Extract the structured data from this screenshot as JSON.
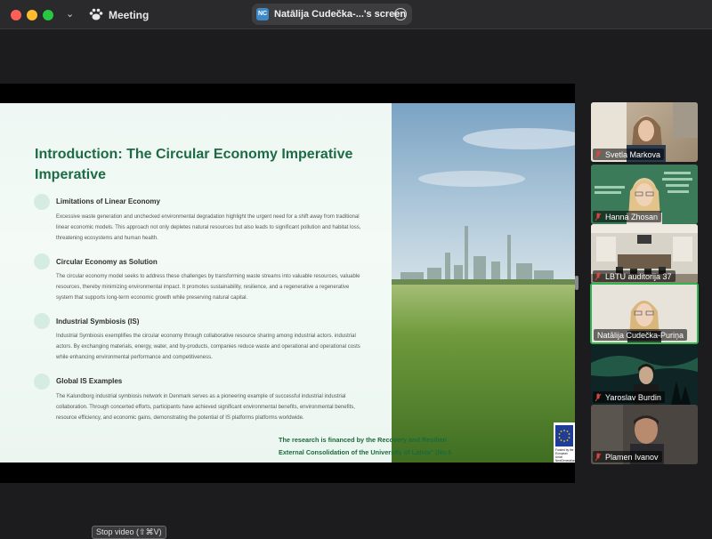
{
  "window": {
    "meeting_title": "Meeting",
    "share_badge": "NC",
    "share_label": "Natālija Cudečka-...'s screen"
  },
  "slide": {
    "title_line1": "Introduction: The Circular Economy Imperative",
    "title_line2": "Imperative",
    "sections": [
      {
        "heading": "Limitations of Linear Economy",
        "body": "Excessive waste generation and unchecked environmental degradation highlight the urgent need for a shift away from traditional linear economic models. This approach not only depletes natural resources but also leads to significant pollution and habitat loss, threatening ecosystems and human health."
      },
      {
        "heading": "Circular Economy as Solution",
        "body": "The circular economy model seeks to address these challenges by transforming waste streams into valuable resources, valuable resources, thereby minimizing environmental impact. It promotes sustainability, resilience, and a regenerative a regenerative system that supports long-term economic growth while preserving natural capital."
      },
      {
        "heading": "Industrial Symbiosis (IS)",
        "body": "Industrial Symbiosis exemplifies the circular economy through collaborative resource sharing among industrial actors. industrial actors. By exchanging materials, energy, water, and by-products, companies reduce waste and operational and operational costs while enhancing environmental performance and competitiveness."
      },
      {
        "heading": "Global IS Examples",
        "body": "The Kalundborg industrial symbiosis network in Denmark serves as a pioneering example of successful industrial industrial collaboration. Through concerted efforts, participants have achieved significant environmental benefits, environmental benefits, resource efficiency, and economic gains, demonstrating the potential of IS platforms platforms worldwide."
      }
    ],
    "funding_line1": "The research is financed by the Recovery and Resilien",
    "funding_line2": "External Consolidation of the University of Latvia\" (No.5",
    "eu_logo_text": "Funded by the European Union NextGenerationEU"
  },
  "participants": [
    {
      "name": "Svetla Markova",
      "active": false
    },
    {
      "name": "Hanna Zhosan",
      "active": false
    },
    {
      "name": "LBTU auditorija 37",
      "active": false
    },
    {
      "name": "Natālija Cudečka-Puriņa",
      "active": true
    },
    {
      "name": "Yaroslav Burdin",
      "active": false
    },
    {
      "name": "Plamen Ivanov",
      "active": false
    }
  ],
  "footer": {
    "stop_video_tooltip": "Stop video (⇧⌘V)"
  },
  "colors": {
    "title_green": "#1d6b45",
    "active_speaker": "#2fb44e",
    "mic_muted": "#e0443a"
  }
}
